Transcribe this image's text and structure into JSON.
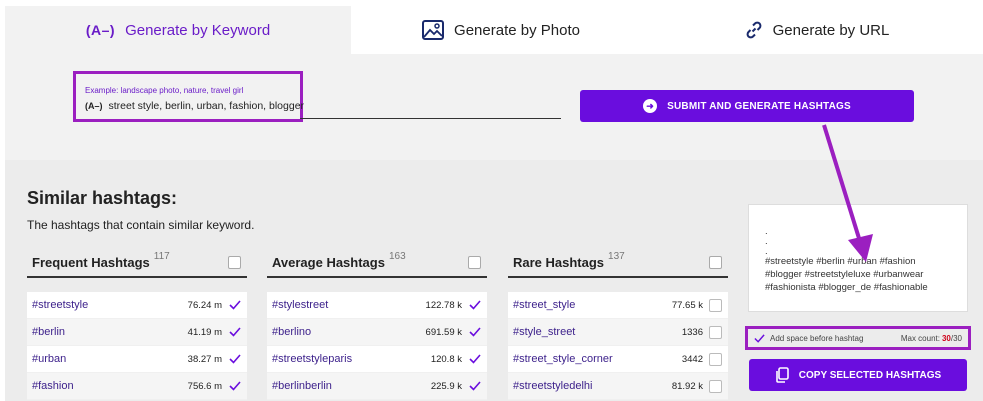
{
  "tabs": [
    {
      "icon": "(A–)",
      "label": "Generate by Keyword",
      "active": true
    },
    {
      "icon": "image-icon",
      "label": "Generate by Photo",
      "active": false
    },
    {
      "icon": "link-icon",
      "label": "Generate by URL",
      "active": false
    }
  ],
  "search": {
    "example": "Example: landscape photo, nature, travel girl",
    "icon": "(A–)",
    "value": "street style, berlin, urban, fashion, blogger"
  },
  "submit_label": "SUBMIT AND GENERATE HASHTAGS",
  "similar": {
    "title": "Similar hashtags:",
    "subtitle": "The hashtags that contain similar keyword."
  },
  "columns": [
    {
      "title": "Frequent Hashtags",
      "count": "117",
      "rows": [
        {
          "tag": "#streetstyle",
          "count": "76.24 m",
          "checked": true
        },
        {
          "tag": "#berlin",
          "count": "41.19 m",
          "checked": true
        },
        {
          "tag": "#urban",
          "count": "38.27 m",
          "checked": true
        },
        {
          "tag": "#fashion",
          "count": "756.6 m",
          "checked": true
        }
      ]
    },
    {
      "title": "Average Hashtags",
      "count": "163",
      "rows": [
        {
          "tag": "#stylestreet",
          "count": "122.78 k",
          "checked": true
        },
        {
          "tag": "#berlino",
          "count": "691.59 k",
          "checked": true
        },
        {
          "tag": "#streetstyleparis",
          "count": "120.8 k",
          "checked": true
        },
        {
          "tag": "#berlinberlin",
          "count": "225.9 k",
          "checked": true
        }
      ]
    },
    {
      "title": "Rare Hashtags",
      "count": "137",
      "rows": [
        {
          "tag": "#street_style",
          "count": "77.65 k",
          "checked": false
        },
        {
          "tag": "#style_street",
          "count": "1336",
          "checked": false
        },
        {
          "tag": "#street_style_corner",
          "count": "3442",
          "checked": false
        },
        {
          "tag": "#streetstyledelhi",
          "count": "81.92 k",
          "checked": false
        }
      ]
    }
  ],
  "selected_text": {
    "dots": [
      ".",
      ".",
      "."
    ],
    "lines": [
      "#streetstyle #berlin #urban #fashion",
      "#blogger #streetstyleluxe #urbanwear",
      "#fashionista #blogger_de #fashionable"
    ]
  },
  "options": {
    "space_label": "Add space before hashtag",
    "max_label": "Max count:",
    "max_current": "30",
    "max_total": "/30"
  },
  "copy_label": "COPY SELECTED HASHTAGS",
  "colors": {
    "accent": "#6a0dde",
    "highlight_border": "#9b1fc0",
    "arrow": "#9b1fc0",
    "tag_text": "#3b1f8a"
  }
}
